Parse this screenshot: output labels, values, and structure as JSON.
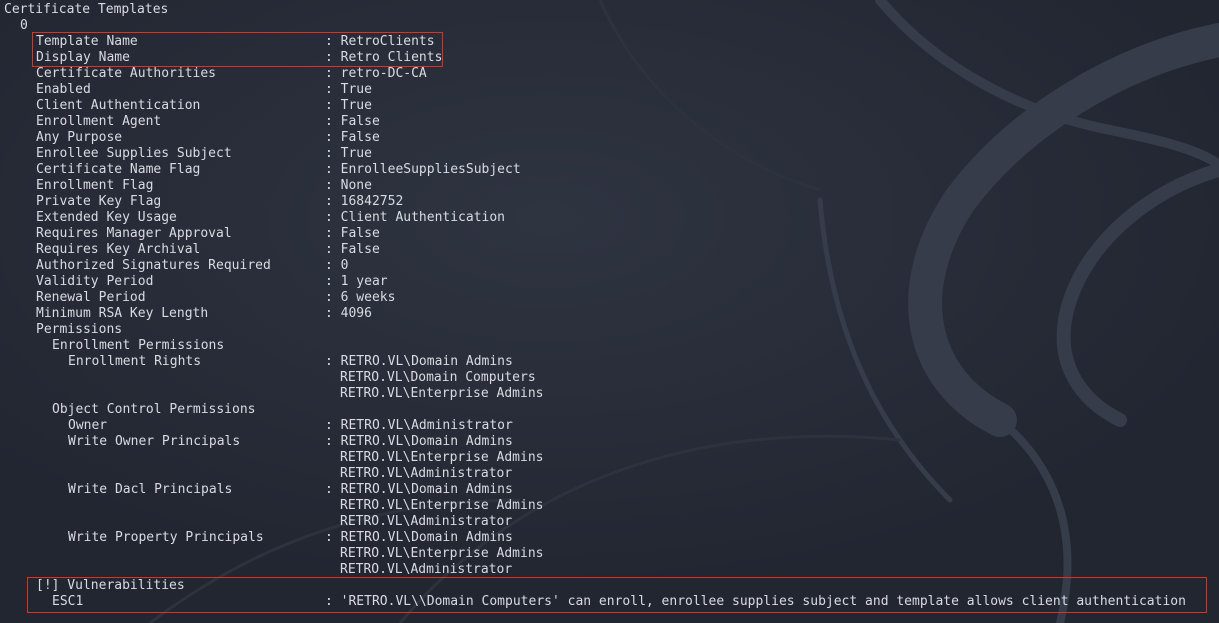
{
  "terminal": {
    "header": "Certificate Templates",
    "index": "0",
    "fields": [
      {
        "label": "Template Name",
        "value": ": RetroClients"
      },
      {
        "label": "Display Name",
        "value": ": Retro Clients"
      },
      {
        "label": "Certificate Authorities",
        "value": ": retro-DC-CA"
      },
      {
        "label": "Enabled",
        "value": ": True"
      },
      {
        "label": "Client Authentication",
        "value": ": True"
      },
      {
        "label": "Enrollment Agent",
        "value": ": False"
      },
      {
        "label": "Any Purpose",
        "value": ": False"
      },
      {
        "label": "Enrollee Supplies Subject",
        "value": ": True"
      },
      {
        "label": "Certificate Name Flag",
        "value": ": EnrolleeSuppliesSubject"
      },
      {
        "label": "Enrollment Flag",
        "value": ": None"
      },
      {
        "label": "Private Key Flag",
        "value": ": 16842752"
      },
      {
        "label": "Extended Key Usage",
        "value": ": Client Authentication"
      },
      {
        "label": "Requires Manager Approval",
        "value": ": False"
      },
      {
        "label": "Requires Key Archival",
        "value": ": False"
      },
      {
        "label": "Authorized Signatures Required",
        "value": ": 0"
      },
      {
        "label": "Validity Period",
        "value": ": 1 year"
      },
      {
        "label": "Renewal Period",
        "value": ": 6 weeks"
      },
      {
        "label": "Minimum RSA Key Length",
        "value": ": 4096"
      }
    ],
    "permissions_heading": "Permissions",
    "enrollment_permissions": {
      "heading": "Enrollment Permissions",
      "label": "Enrollment Rights",
      "values": [
        ": RETRO.VL\\Domain Admins",
        "RETRO.VL\\Domain Computers",
        "RETRO.VL\\Enterprise Admins"
      ]
    },
    "object_control": {
      "heading": "Object Control Permissions",
      "owner_label": "Owner",
      "owner_value": ": RETRO.VL\\Administrator",
      "write_owner": {
        "label": "Write Owner Principals",
        "values": [
          ": RETRO.VL\\Domain Admins",
          "RETRO.VL\\Enterprise Admins",
          "RETRO.VL\\Administrator"
        ]
      },
      "write_dacl": {
        "label": "Write Dacl Principals",
        "values": [
          ": RETRO.VL\\Domain Admins",
          "RETRO.VL\\Enterprise Admins",
          "RETRO.VL\\Administrator"
        ]
      },
      "write_property": {
        "label": "Write Property Principals",
        "values": [
          ": RETRO.VL\\Domain Admins",
          "RETRO.VL\\Enterprise Admins",
          "RETRO.VL\\Administrator"
        ]
      }
    },
    "vulnerabilities": {
      "heading": "[!] Vulnerabilities",
      "label": "ESC1",
      "value": ": 'RETRO.VL\\\\Domain Computers' can enroll, enrollee supplies subject and template allows client authentication"
    }
  },
  "colors": {
    "background": "#242834",
    "text": "#d8dbe2",
    "highlight_box": "#e0311f"
  }
}
